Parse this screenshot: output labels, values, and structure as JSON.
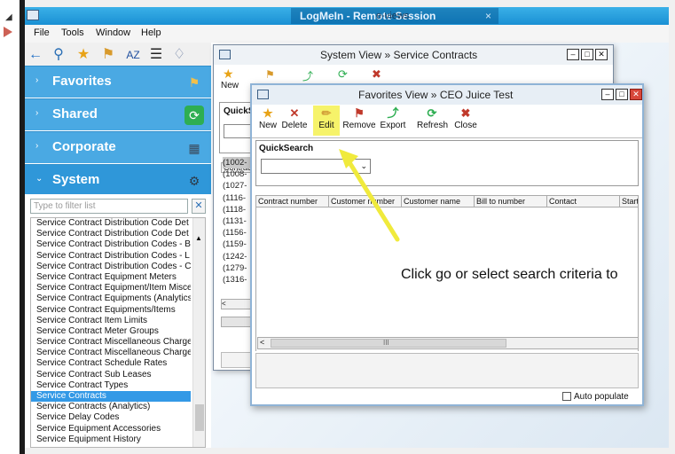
{
  "remote_title": "LogMeIn - Remote Session",
  "remote_overlay": "e-views",
  "menu": [
    "File",
    "Tools",
    "Window",
    "Help"
  ],
  "nav": {
    "sections": [
      {
        "label": "Favorites",
        "icon": "bookmark-icon"
      },
      {
        "label": "Shared",
        "icon": "share-icon"
      },
      {
        "label": "Corporate",
        "icon": "building-icon"
      },
      {
        "label": "System",
        "icon": "gears-icon"
      }
    ],
    "filter_placeholder": "Type to filter list",
    "items": [
      "Service Contract Distribution Code Det",
      "Service Contract Distribution Code Det",
      "Service Contract Distribution Codes - B",
      "Service Contract Distribution Codes - L",
      "Service Contract Distribution Codes - C",
      "Service Contract Equipment Meters",
      "Service Contract Equipment/Item Misce",
      "Service Contract Equipments (Analytics",
      "Service Contract Equipments/Items",
      "Service Contract Item Limits",
      "Service Contract Meter Groups",
      "Service Contract Miscellaneous Charge",
      "Service Contract Miscellaneous Charge",
      "Service Contract Schedule Rates",
      "Service Contract Sub Leases",
      "Service Contract Types",
      "Service Contracts",
      "Service Contracts (Analytics)",
      "Service Delay Codes",
      "Service Equipment Accessories",
      "Service Equipment History"
    ],
    "selected_index": 16
  },
  "system_view": {
    "title": "System View » Service Contracts",
    "new_label": "New",
    "quicksearch_label": "QuickS",
    "column_label": "Contrac",
    "rows": [
      "(1002-",
      "(1008-",
      "(1027-",
      "(1116-",
      "(1118-",
      "(1131-",
      "(1156-",
      "(1159-",
      "(1242-",
      "(1279-",
      "(1316-"
    ]
  },
  "favorites_view": {
    "title": "Favorites View » CEO Juice Test",
    "toolbar": [
      {
        "label": "New",
        "icon": "star-icon"
      },
      {
        "label": "Delete",
        "icon": "delete-x-icon"
      },
      {
        "label": "Edit",
        "icon": "pencil-icon"
      },
      {
        "label": "Remove",
        "icon": "remove-icon"
      },
      {
        "label": "Export",
        "icon": "export-icon"
      },
      {
        "label": "Refresh",
        "icon": "refresh-icon"
      },
      {
        "label": "Close",
        "icon": "close-circle-icon"
      }
    ],
    "quicksearch_label": "QuickSearch",
    "columns": [
      "Contract number",
      "Customer number",
      "Customer name",
      "Bill to number",
      "Contact",
      "Start"
    ],
    "grid_message": "Click go or select search criteria to",
    "hscroll_label": "III",
    "auto_populate_label": "Auto populate",
    "auto_populate_checked": false
  },
  "colors": {
    "accent": "#4aa9e3",
    "titlebar": "#1a90d4",
    "highlight": "#f6f36a",
    "selection": "#3399e6"
  }
}
